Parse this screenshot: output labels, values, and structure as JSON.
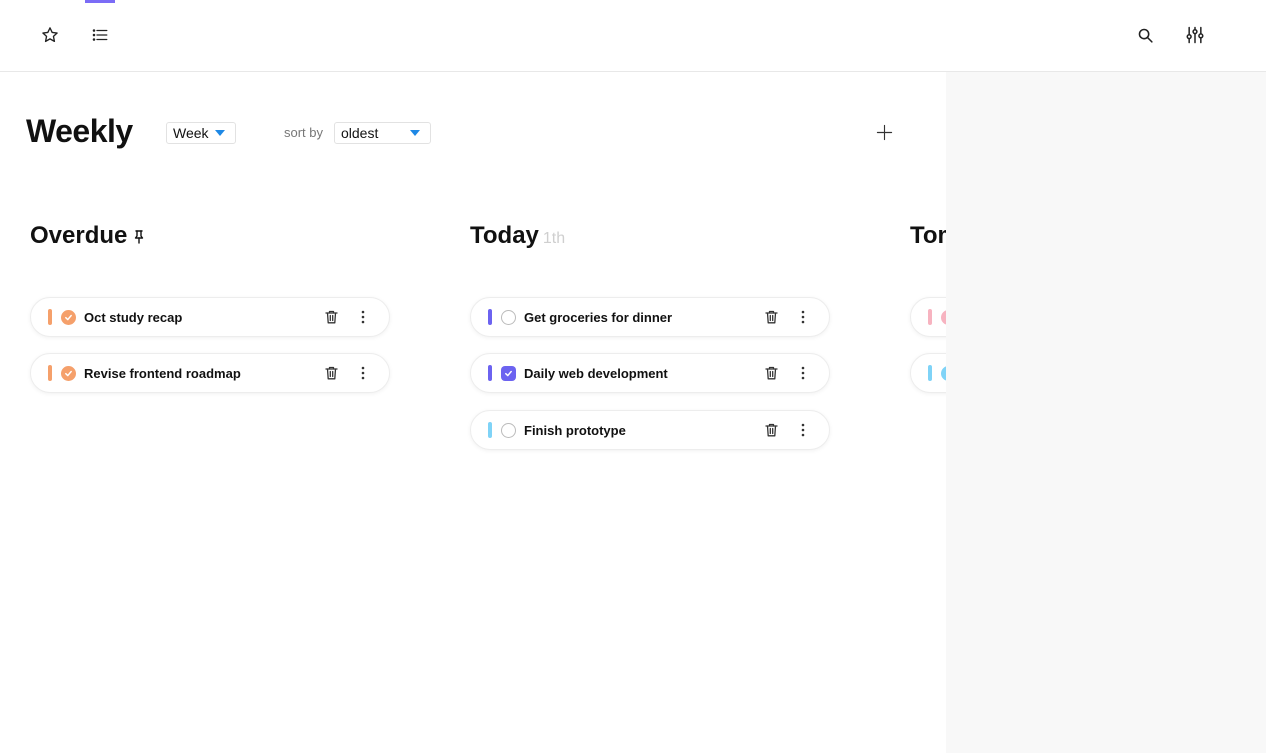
{
  "topbar": {
    "icons": [
      "star-icon",
      "list-icon",
      "search-icon",
      "sliders-icon"
    ],
    "accent": "#7b6cf6"
  },
  "header": {
    "title": "Weekly",
    "period_value": "Week",
    "sort_label": "sort by",
    "sort_value": "oldest",
    "add_icon": "plus-icon"
  },
  "columns": [
    {
      "title": "Overdue",
      "subtitle": "",
      "icon": "pin-icon",
      "tasks": [
        {
          "label": "Oct study recap",
          "color": "#f5a06b",
          "done": true
        },
        {
          "label": "Revise frontend roadmap",
          "color": "#f5a06b",
          "done": true
        }
      ]
    },
    {
      "title": "Today",
      "subtitle": "1th",
      "tasks": [
        {
          "label": "Get groceries for dinner",
          "color": "#6c63f0",
          "done": false
        },
        {
          "label": "Daily web development",
          "color": "#6c63f0",
          "done": true
        },
        {
          "label": "Finish prototype",
          "color": "#7fd3f7",
          "done": false
        }
      ]
    },
    {
      "title": "Tomorrow",
      "subtitle": "",
      "tasks": [
        {
          "label": "",
          "color": "#f7b3c0",
          "done": false
        },
        {
          "label": "",
          "color": "#7fd3f7",
          "done": false
        }
      ]
    }
  ],
  "colors": {
    "background": "#ffffff",
    "panel": "#f8f8f8",
    "caret": "#1e88e5"
  }
}
